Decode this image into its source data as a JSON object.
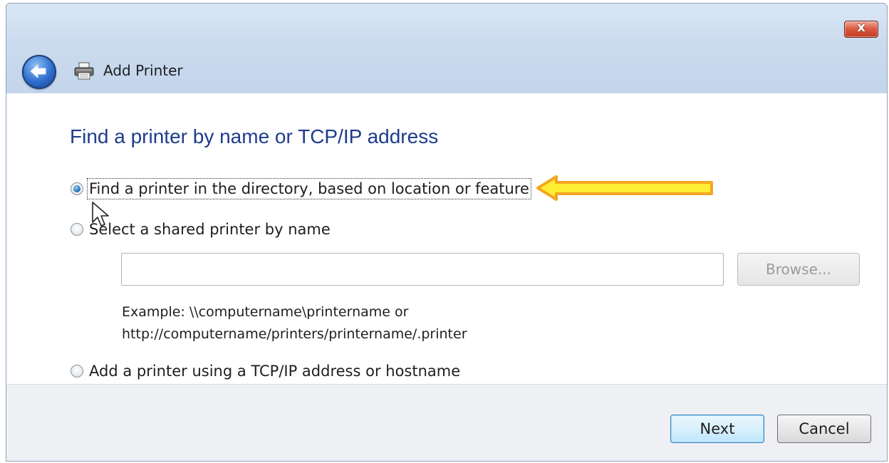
{
  "window": {
    "title": "Add Printer",
    "close_label": "x"
  },
  "page": {
    "heading": "Find a printer by name or TCP/IP address"
  },
  "options": [
    {
      "label": "Find a printer in the directory, based on location or feature",
      "selected": true
    },
    {
      "label": "Select a shared printer by name",
      "selected": false
    },
    {
      "label": "Add a printer using a TCP/IP address or hostname",
      "selected": false
    }
  ],
  "shared_printer": {
    "value": "",
    "browse_label": "Browse...",
    "example_line1": "Example: \\\\computername\\printername or",
    "example_line2": "http://computername/printers/printername/.printer"
  },
  "footer": {
    "next_label": "Next",
    "cancel_label": "Cancel"
  },
  "annotation": {
    "arrow_color": "#f5a623",
    "arrow_fill": "#ffee33"
  }
}
